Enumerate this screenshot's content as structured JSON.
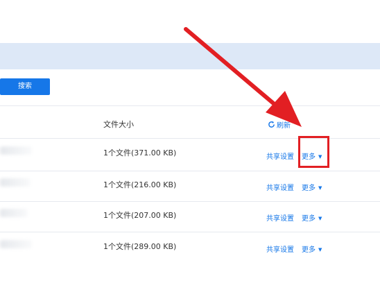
{
  "toolbar": {
    "search_label": "搜索"
  },
  "table": {
    "header_size": "文件大小",
    "refresh_label": "刷新",
    "rows": [
      {
        "size": "1个文件(371.00 KB)",
        "share": "共享设置",
        "more": "更多"
      },
      {
        "size": "1个文件(216.00 KB)",
        "share": "共享设置",
        "more": "更多"
      },
      {
        "size": "1个文件(207.00 KB)",
        "share": "共享设置",
        "more": "更多"
      },
      {
        "size": "1个文件(289.00 KB)",
        "share": "共享设置",
        "more": "更多"
      }
    ]
  },
  "colors": {
    "accent": "#1677e8",
    "annotation": "#e21f23",
    "topbar": "#dde8f7"
  },
  "icons": {
    "refresh": "refresh-icon",
    "caret": "caret-down-icon",
    "annotation_arrow": "red-arrow-icon"
  }
}
